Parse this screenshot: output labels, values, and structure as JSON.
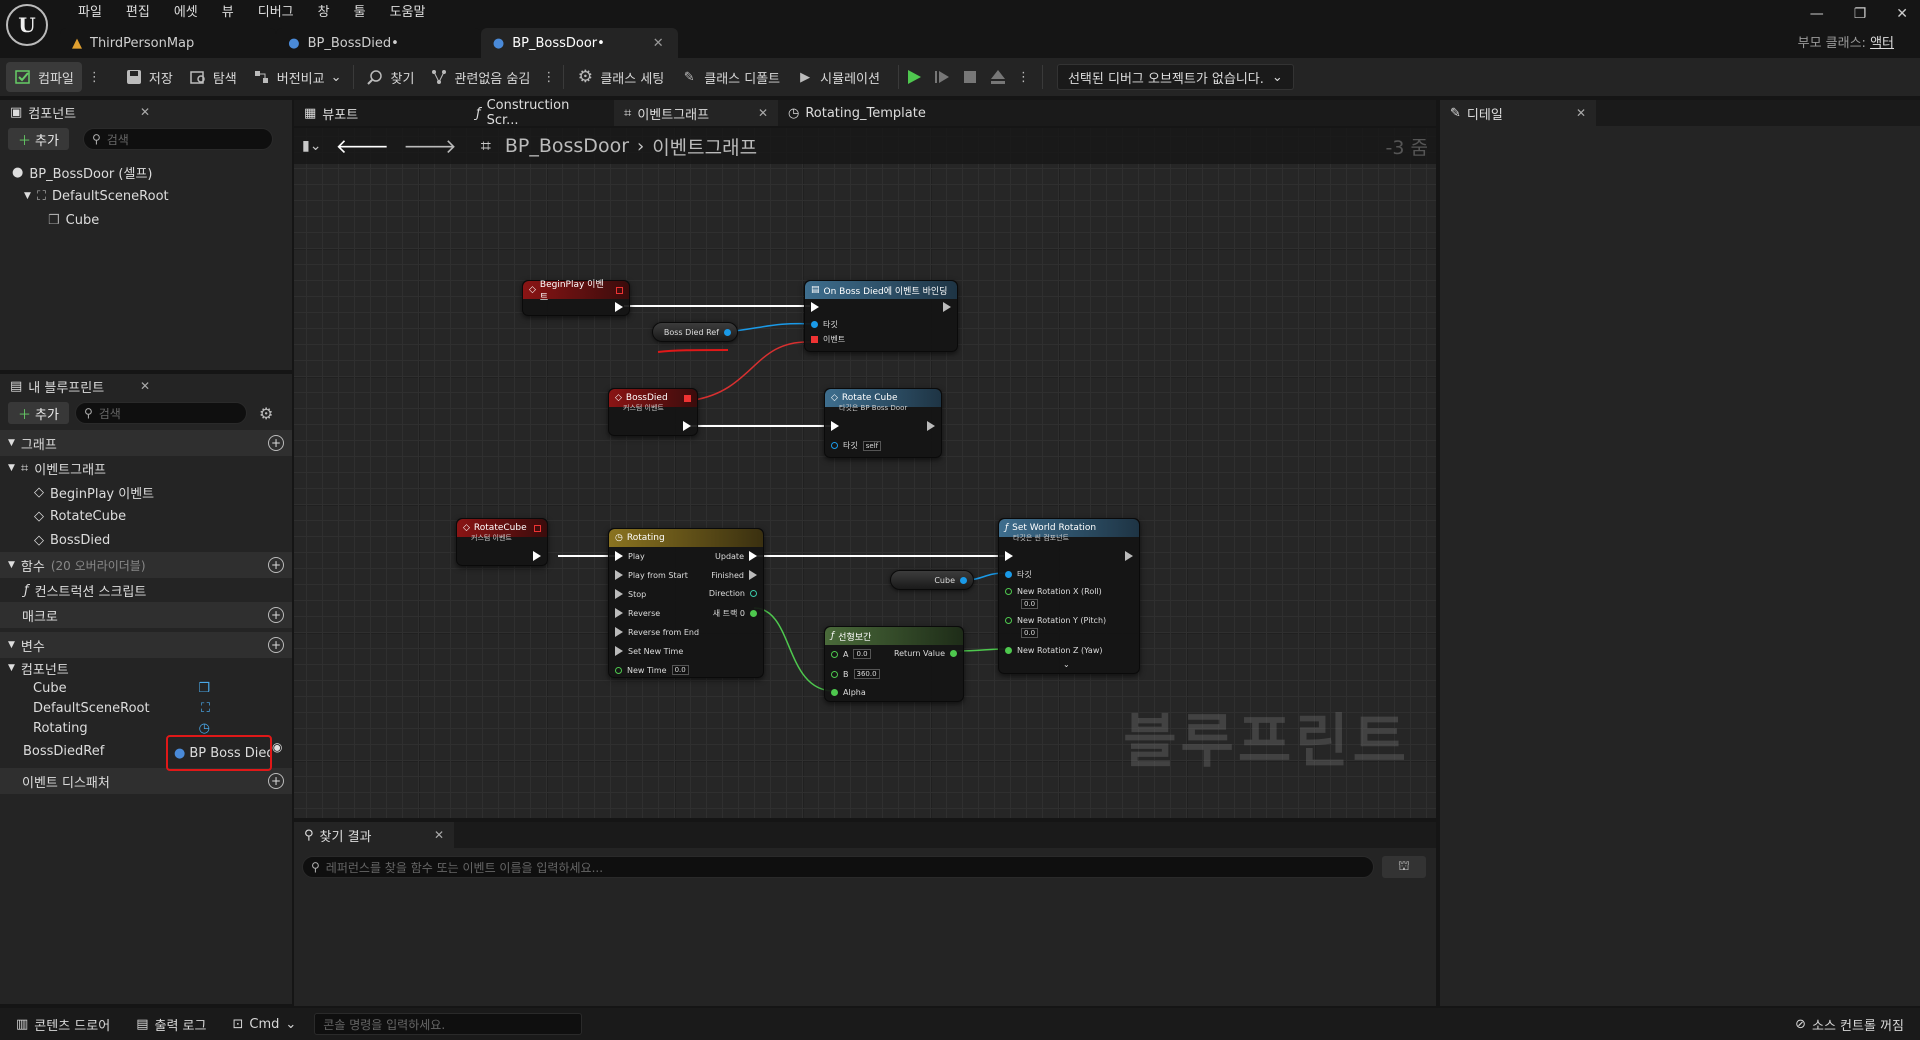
{
  "app": {
    "logo": "U"
  },
  "menu": [
    "파일",
    "편집",
    "에셋",
    "뷰",
    "디버그",
    "창",
    "툴",
    "도움말"
  ],
  "doc_tabs": [
    {
      "label": "ThirdPersonMap",
      "icon": "level-icon"
    },
    {
      "label": "BP_BossDied•",
      "icon": "blueprint-icon"
    },
    {
      "label": "BP_BossDoor•",
      "icon": "blueprint-icon",
      "active": true
    }
  ],
  "parent_class": {
    "label": "부모 클래스:",
    "value": "액터"
  },
  "toolbar": {
    "compile": "컴파일",
    "save": "저장",
    "browse": "탐색",
    "diff": "버전비교",
    "find": "찾기",
    "hide_unrelated": "관련없음 숨김",
    "class_settings": "클래스 세팅",
    "class_defaults": "클래스 디폴트",
    "simulation": "시뮬레이션",
    "debug_object": "선택된 디버그 오브젝트가 없습니다."
  },
  "components_panel": {
    "title": "컴포넌트",
    "add": "추가",
    "search_placeholder": "검색",
    "tree": [
      "BP_BossDoor (셀프)",
      "DefaultSceneRoot",
      "Cube"
    ]
  },
  "my_blueprint": {
    "title": "내 블루프린트",
    "add": "추가",
    "search_placeholder": "검색",
    "graphs": "그래프",
    "event_graph": "이벤트그래프",
    "events": [
      "BeginPlay 이벤트",
      "RotateCube",
      "BossDied"
    ],
    "functions": "함수",
    "functions_note": "(20 오버라이더블)",
    "construction_script": "컨스트럭션 스크립트",
    "macros": "매크로",
    "variables": "변수",
    "components": "컴포넌트",
    "component_vars": [
      "Cube",
      "DefaultSceneRoot",
      "Rotating"
    ],
    "var_name": "BossDiedRef",
    "var_type": "BP Boss Died",
    "event_dispatchers": "이벤트 디스패처"
  },
  "editor_tabs": [
    {
      "label": "뷰포트"
    },
    {
      "label": "Construction Scr..."
    },
    {
      "label": "이벤트그래프",
      "active": true
    },
    {
      "label": "Rotating_Template"
    }
  ],
  "breadcrumb": {
    "root": "BP_BossDoor",
    "current": "이벤트그래프",
    "zoom": "-3 줌"
  },
  "nodes": {
    "beginplay": {
      "title": "BeginPlay 이벤트"
    },
    "bind": {
      "title": "On Boss Died에 이벤트 바인딩",
      "target": "타깃",
      "event": "이벤트"
    },
    "bossdiedref": {
      "label": "Boss Died Ref"
    },
    "bossdied": {
      "title": "BossDied",
      "sub": "커스텀 이벤트"
    },
    "rotatecube_call": {
      "title": "Rotate Cube",
      "sub": "타깃은 BP Boss Door",
      "target": "타깃",
      "self": "self"
    },
    "rotatecube_evt": {
      "title": "RotateCube",
      "sub": "커스텀 이벤트"
    },
    "timeline": {
      "title": "Rotating",
      "play": "Play",
      "play_from_start": "Play from Start",
      "stop": "Stop",
      "reverse": "Reverse",
      "reverse_from_end": "Reverse from End",
      "set_new_time": "Set New Time",
      "new_time": "New Time",
      "new_time_val": "0.0",
      "update": "Update",
      "finished": "Finished",
      "direction": "Direction",
      "track": "새 트랙 0"
    },
    "cube_var": {
      "label": "Cube"
    },
    "lerp": {
      "title": "선형보간",
      "a": "A",
      "a_val": "0.0",
      "b": "B",
      "b_val": "360.0",
      "alpha": "Alpha",
      "ret": "Return Value"
    },
    "setrot": {
      "title": "Set World Rotation",
      "sub": "타깃은 씬 컴포넌트",
      "target": "타깃",
      "x": "New Rotation X (Roll)",
      "x_val": "0.0",
      "y": "New Rotation Y (Pitch)",
      "y_val": "0.0",
      "z": "New Rotation Z (Yaw)"
    }
  },
  "watermark": "블루프린트",
  "details": {
    "title": "디테일"
  },
  "find_results": {
    "title": "찾기 결과",
    "placeholder": "레퍼런스를 찾을 함수 또는 이벤트 이름을 입력하세요..."
  },
  "statusbar": {
    "content_drawer": "콘텐츠 드로어",
    "output_log": "출력 로그",
    "cmd": "Cmd",
    "console_placeholder": "콘솔 명령을 입력하세요.",
    "source_control": "소스 컨트롤 꺼짐"
  }
}
